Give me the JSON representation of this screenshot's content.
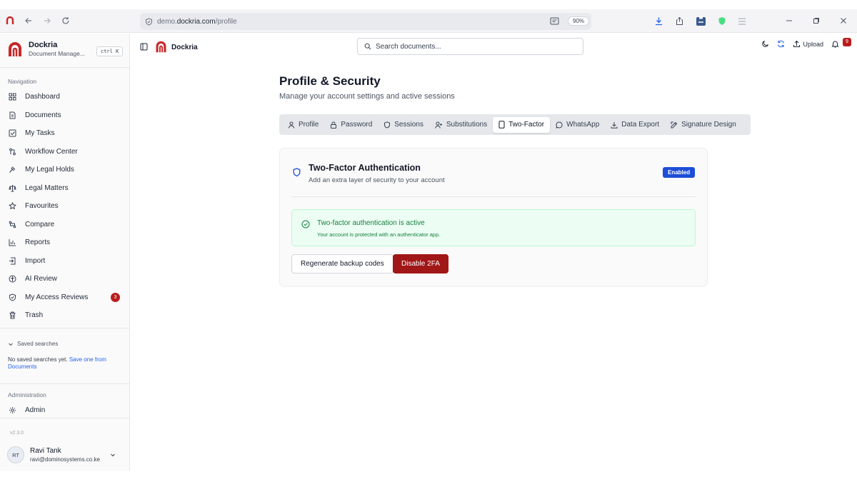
{
  "browser": {
    "url_prefix": "demo.",
    "url_host": "dockria.com",
    "url_path": "/profile",
    "zoom": "90%"
  },
  "sidebar": {
    "brand_name": "Dockria",
    "brand_sub": "Document Manage...",
    "shortcut": "ctrl K",
    "nav_label": "Navigation",
    "items": [
      {
        "label": "Dashboard",
        "icon": "dashboard-icon"
      },
      {
        "label": "Documents",
        "icon": "document-icon"
      },
      {
        "label": "My Tasks",
        "icon": "tasks-icon"
      },
      {
        "label": "Workflow Center",
        "icon": "workflow-icon"
      },
      {
        "label": "My Legal Holds",
        "icon": "gavel-icon"
      },
      {
        "label": "Legal Matters",
        "icon": "scale-icon"
      },
      {
        "label": "Favourites",
        "icon": "star-icon"
      },
      {
        "label": "Compare",
        "icon": "compare-icon"
      },
      {
        "label": "Reports",
        "icon": "chart-icon"
      },
      {
        "label": "Import",
        "icon": "import-icon"
      },
      {
        "label": "AI Review",
        "icon": "ai-icon"
      },
      {
        "label": "My Access Reviews",
        "icon": "shield-check-icon",
        "badge": "3"
      },
      {
        "label": "Trash",
        "icon": "trash-icon"
      }
    ],
    "saved_label": "Saved searches",
    "saved_empty": "No saved searches yet.",
    "saved_link": "Save one from Documents",
    "admin_label": "Administration",
    "admin_item": "Admin",
    "version": "v2.3.0",
    "user_initials": "RT",
    "user_name": "Ravi Tank",
    "user_email": "ravi@dominosystems.co.ke"
  },
  "topbar": {
    "app_name": "Dockria",
    "search_placeholder": "Search documents...",
    "upload_label": "Upload",
    "notif_count": "9"
  },
  "page": {
    "title": "Profile & Security",
    "subtitle": "Manage your account settings and active sessions",
    "tabs": [
      {
        "label": "Profile",
        "icon": "user-icon"
      },
      {
        "label": "Password",
        "icon": "lock-icon"
      },
      {
        "label": "Sessions",
        "icon": "shield-icon"
      },
      {
        "label": "Substitutions",
        "icon": "user-plus-icon"
      },
      {
        "label": "Two-Factor",
        "icon": "phone-icon",
        "active": true
      },
      {
        "label": "WhatsApp",
        "icon": "chat-icon"
      },
      {
        "label": "Data Export",
        "icon": "download-icon"
      },
      {
        "label": "Signature Design",
        "icon": "pen-icon"
      }
    ]
  },
  "twofa": {
    "title": "Two-Factor Authentication",
    "description": "Add an extra layer of security to your account",
    "status_badge": "Enabled",
    "alert_title": "Two-factor authentication is active",
    "alert_desc": "Your account is protected with an authenticator app.",
    "regen_label": "Regenerate backup codes",
    "disable_label": "Disable 2FA"
  },
  "colors": {
    "brand_red": "#b91c1c",
    "accent_blue": "#1d4ed8",
    "success_green": "#15803d",
    "danger_button": "#a11616"
  }
}
